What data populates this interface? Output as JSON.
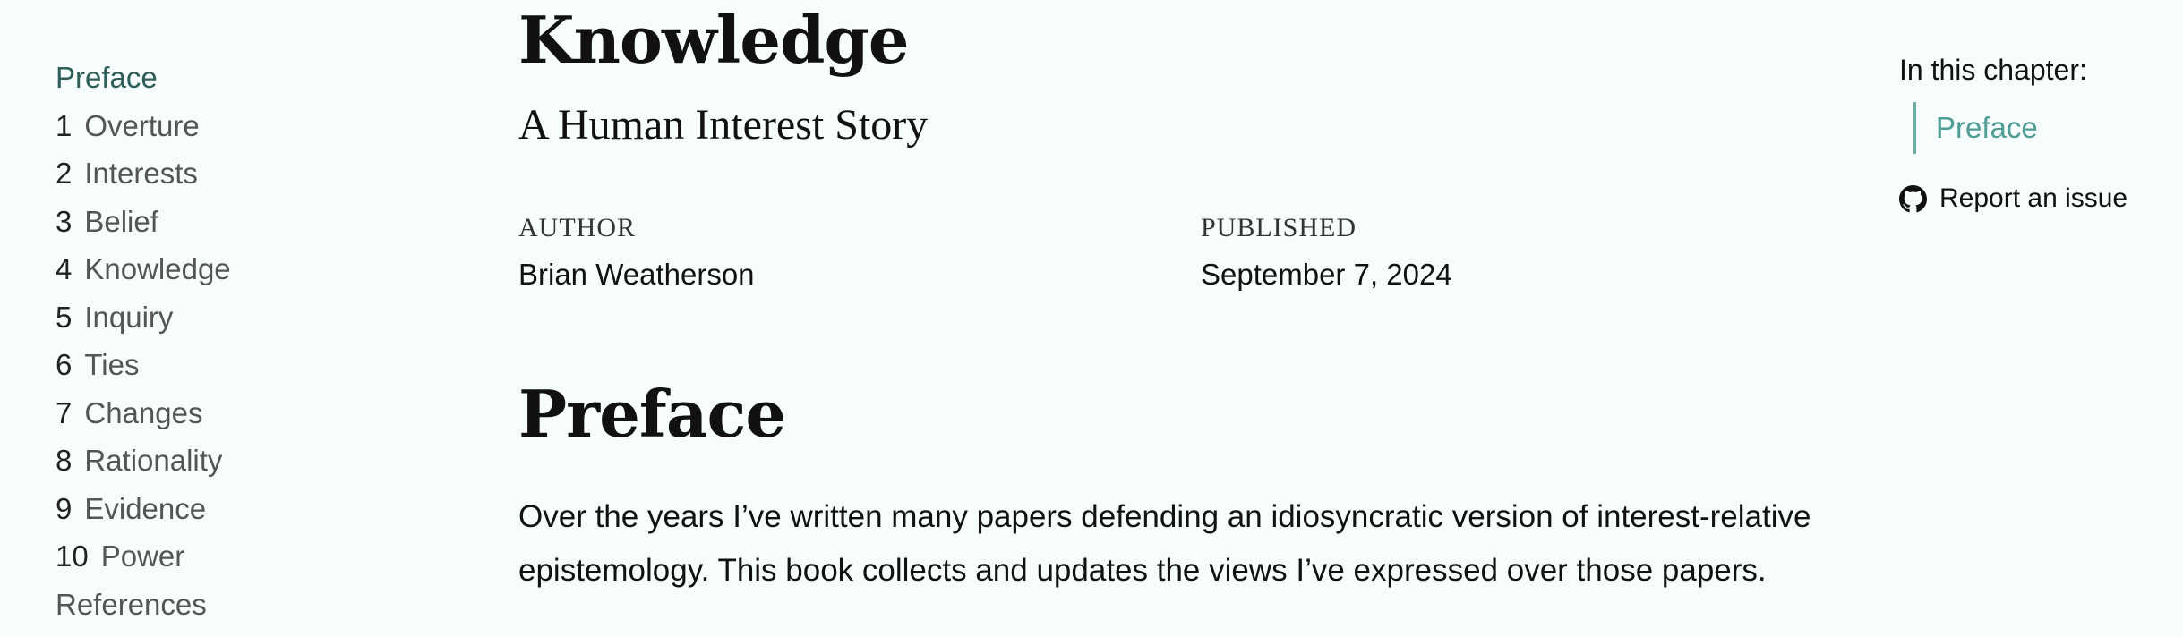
{
  "sidebar": {
    "items": [
      {
        "num": "",
        "label": "Preface"
      },
      {
        "num": "1",
        "label": "Overture"
      },
      {
        "num": "2",
        "label": "Interests"
      },
      {
        "num": "3",
        "label": "Belief"
      },
      {
        "num": "4",
        "label": "Knowledge"
      },
      {
        "num": "5",
        "label": "Inquiry"
      },
      {
        "num": "6",
        "label": "Ties"
      },
      {
        "num": "7",
        "label": "Changes"
      },
      {
        "num": "8",
        "label": "Rationality"
      },
      {
        "num": "9",
        "label": "Evidence"
      },
      {
        "num": "10",
        "label": "Power"
      },
      {
        "num": "",
        "label": "References"
      }
    ]
  },
  "main": {
    "title": "Knowledge",
    "subtitle": "A Human Interest Story",
    "author_label": "AUTHOR",
    "author": "Brian Weatherson",
    "published_label": "PUBLISHED",
    "published": "September 7, 2024",
    "section_heading": "Preface",
    "paragraph": "Over the years I’ve written many papers defending an idiosyncratic version of interest-relative epistemology. This book collects and updates the views I’ve expressed over those papers."
  },
  "toc": {
    "title": "In this chapter:",
    "items": [
      "Preface"
    ],
    "report_label": "Report an issue",
    "report_icon": "github-icon"
  },
  "colors": {
    "background": "#f7fdfd",
    "sidebar_active": "#2e5e59",
    "toc_link": "#4f9d94",
    "toc_border": "#6aaea6"
  }
}
